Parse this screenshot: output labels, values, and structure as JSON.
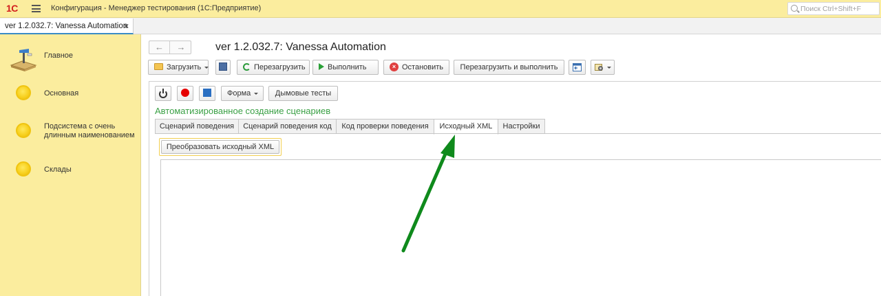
{
  "topbar": {
    "logo": "1С",
    "title": "Конфигурация  - Менеджер тестирования (1С:Предприятие)",
    "search_placeholder": "Поиск Ctrl+Shift+F"
  },
  "tabstrip": {
    "active_tab": "ver 1.2.032.7: Vanessa Automation",
    "close": "×"
  },
  "sidebar": {
    "items": [
      {
        "label": "Главное",
        "icon": "home-desk-icon"
      },
      {
        "label": "Основная",
        "icon": "yellow-circle-icon"
      },
      {
        "label": "Подсистема с очень\nдлинным наименованием",
        "icon": "yellow-circle-icon"
      },
      {
        "label": "Склады",
        "icon": "yellow-circle-icon"
      }
    ]
  },
  "form": {
    "nav_back": "←",
    "nav_forward": "→",
    "title": "ver 1.2.032.7: Vanessa Automation"
  },
  "toolbar": {
    "load": "Загрузить",
    "reload": "Перезагрузить",
    "run": "Выполнить",
    "stop": "Остановить",
    "reload_run": "Перезагрузить и выполнить"
  },
  "panel": {
    "form_btn": "Форма",
    "smoke_tests": "Дымовые тесты",
    "section_title": "Автоматизированное создание сценариев",
    "tabs": [
      "Сценарий поведения",
      "Сценарий поведения код",
      "Код проверки поведения",
      "Исходный XML",
      "Настройки"
    ],
    "active_tab_index": 3,
    "convert_button": "Преобразовать исходный XML"
  },
  "colors": {
    "topbar": "#fbed9e",
    "section_title": "#3aa045",
    "arrow": "#0f8a1c",
    "accent_tab": "#3a8cc6"
  }
}
